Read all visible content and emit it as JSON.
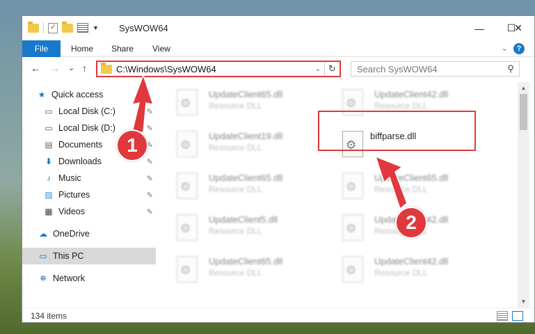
{
  "window": {
    "title": "SysWOW64",
    "minimize": "—",
    "maximize": "☐",
    "close": "✕"
  },
  "ribbon": {
    "tabs": [
      "File",
      "Home",
      "Share",
      "View"
    ],
    "expand_icon": "chevron-down-icon",
    "help_label": "?"
  },
  "nav": {
    "back": "←",
    "forward": "→",
    "recent": "⌄",
    "up": "↑",
    "address": "C:\\Windows\\SysWOW64",
    "refresh": "↻",
    "search_placeholder": "Search SysWOW64"
  },
  "sidebar": {
    "items": [
      {
        "label": "Quick access",
        "icon": "star-icon"
      },
      {
        "label": "Local Disk (C:)",
        "icon": "drive-icon"
      },
      {
        "label": "Local Disk (D:)",
        "icon": "drive-icon"
      },
      {
        "label": "Documents",
        "icon": "documents-icon"
      },
      {
        "label": "Downloads",
        "icon": "download-icon"
      },
      {
        "label": "Music",
        "icon": "music-icon"
      },
      {
        "label": "Pictures",
        "icon": "pictures-icon"
      },
      {
        "label": "Videos",
        "icon": "videos-icon"
      },
      {
        "label": "OneDrive",
        "icon": "cloud-icon"
      },
      {
        "label": "This PC",
        "icon": "pc-icon"
      },
      {
        "label": "Network",
        "icon": "network-icon"
      }
    ]
  },
  "files": [
    {
      "name": "UpdateClient65.dll",
      "type": "Resource DLL"
    },
    {
      "name": "UpdateClient42.dll",
      "type": "Resource DLL"
    },
    {
      "name": "UpdateClient19.dll",
      "type": "Resource DLL"
    },
    {
      "name": "biffparse.dll",
      "type": ""
    },
    {
      "name": "UpdateClient65.dll",
      "type": "Resource DLL"
    },
    {
      "name": "UpdateClient65.dll",
      "type": "Resource DLL"
    },
    {
      "name": "UpdateClient5.dll",
      "type": "Resource DLL"
    },
    {
      "name": "UpdateClient42.dll",
      "type": "Resource DLL"
    },
    {
      "name": "UpdateClient65.dll",
      "type": "Resource DLL"
    },
    {
      "name": "UpdateClient42.dll",
      "type": "Resource DLL"
    }
  ],
  "status": {
    "item_count": "134 items"
  },
  "annotations": {
    "step1": "1",
    "step2": "2",
    "color": "#e0383c"
  }
}
